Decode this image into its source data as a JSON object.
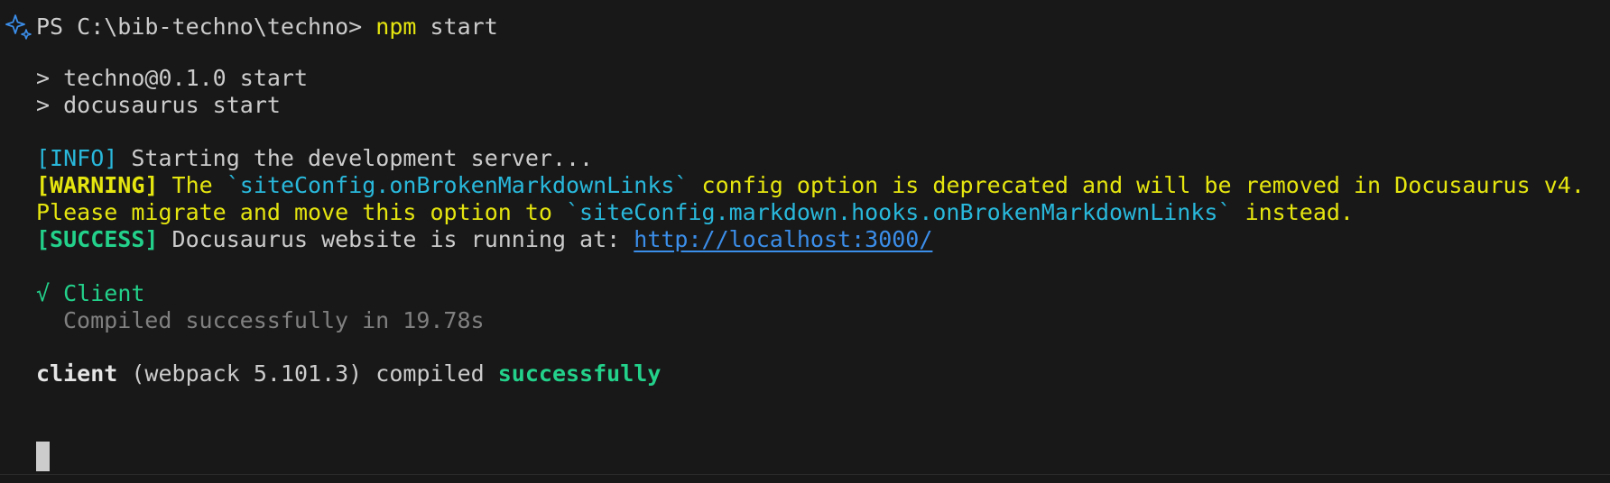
{
  "terminal": {
    "prompt": {
      "prefix": "PS C:\\bib-techno\\techno> ",
      "command": "npm",
      "args": " start"
    },
    "script_lines": [
      "> techno@0.1.0 start",
      "> docusaurus start"
    ],
    "info": {
      "tag": "[INFO]",
      "text": " Starting the development server..."
    },
    "warning": {
      "tag": "[WARNING]",
      "part1": " The ",
      "option_old": "`siteConfig.onBrokenMarkdownLinks`",
      "part2": " config option is deprecated and will be removed in Docusaurus v4.",
      "part3": "Please migrate and move this option to ",
      "option_new": "`siteConfig.markdown.hooks.onBrokenMarkdownLinks`",
      "part4": " instead."
    },
    "success": {
      "tag": "[SUCCESS]",
      "text": " Docusaurus website is running at: ",
      "url": "http://localhost:3000/"
    },
    "client": {
      "check": "√",
      "label": " Client",
      "compiled": "Compiled successfully in 19.78s"
    },
    "summary": {
      "name": "client",
      "webpack": " (webpack 5.101.3) compiled ",
      "status": "successfully"
    }
  },
  "colors": {
    "background": "#181818",
    "foreground": "#cccccc",
    "yellow": "#e5e510",
    "cyan": "#29b8db",
    "green": "#23d18b",
    "link": "#3b8eea",
    "gray": "#808080"
  },
  "icons": {
    "prompt_marker": "sparkle-icon"
  }
}
